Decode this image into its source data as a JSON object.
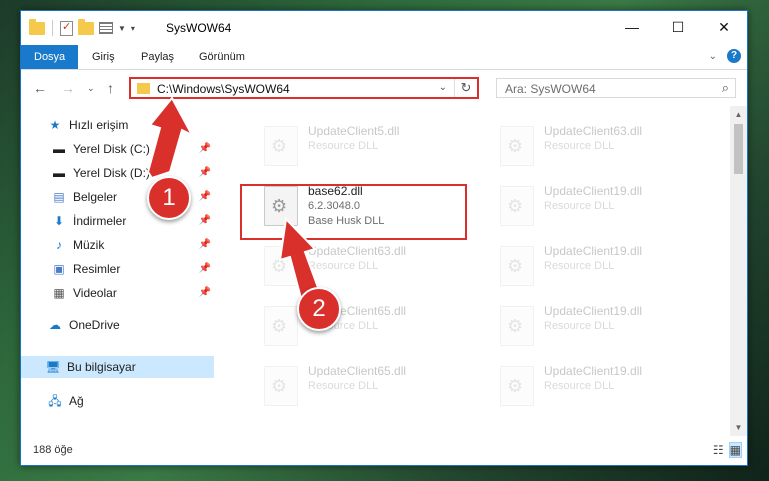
{
  "window": {
    "title": "SysWOW64",
    "minimize": "—",
    "maximize": "☐",
    "close": "✕"
  },
  "ribbon": {
    "tabs": [
      "Dosya",
      "Giriş",
      "Paylaş",
      "Görünüm"
    ]
  },
  "nav": {
    "address": "C:\\Windows\\SysWOW64",
    "search_placeholder": "Ara: SysWOW64"
  },
  "sidebar": {
    "items": [
      {
        "label": "Hızlı erişim",
        "icon": "star-icon"
      },
      {
        "label": "Yerel Disk (C:)",
        "icon": "drive-icon"
      },
      {
        "label": "Yerel Disk (D:)",
        "icon": "drive-icon"
      },
      {
        "label": "Belgeler",
        "icon": "documents-icon"
      },
      {
        "label": "İndirmeler",
        "icon": "download-icon"
      },
      {
        "label": "Müzik",
        "icon": "music-icon"
      },
      {
        "label": "Resimler",
        "icon": "pictures-icon"
      },
      {
        "label": "Videolar",
        "icon": "videos-icon"
      },
      {
        "label": "OneDrive",
        "icon": "cloud-icon"
      },
      {
        "label": "Bu bilgisayar",
        "icon": "computer-icon"
      },
      {
        "label": "Ağ",
        "icon": "network-icon"
      }
    ]
  },
  "files": [
    {
      "name": "UpdateClient5.dll",
      "type": "Resource DLL"
    },
    {
      "name": "UpdateClient63.dll",
      "type": "Resource DLL"
    },
    {
      "name": "base62.dll",
      "version": "6.2.3048.0",
      "type": "Base Husk DLL"
    },
    {
      "name": "UpdateClient19.dll",
      "type": "Resource DLL"
    },
    {
      "name": "UpdateClient63.dll",
      "type": "Resource DLL"
    },
    {
      "name": "UpdateClient19.dll",
      "type": "Resource DLL"
    },
    {
      "name": "UpdateClient65.dll",
      "type": "Resource DLL"
    },
    {
      "name": "UpdateClient19.dll",
      "type": "Resource DLL"
    },
    {
      "name": "UpdateClient65.dll",
      "type": "Resource DLL"
    },
    {
      "name": "UpdateClient19.dll",
      "type": "Resource DLL"
    }
  ],
  "status": {
    "count": "188 öğe"
  },
  "annotations": {
    "step1": "1",
    "step2": "2",
    "color": "#d9302c"
  }
}
